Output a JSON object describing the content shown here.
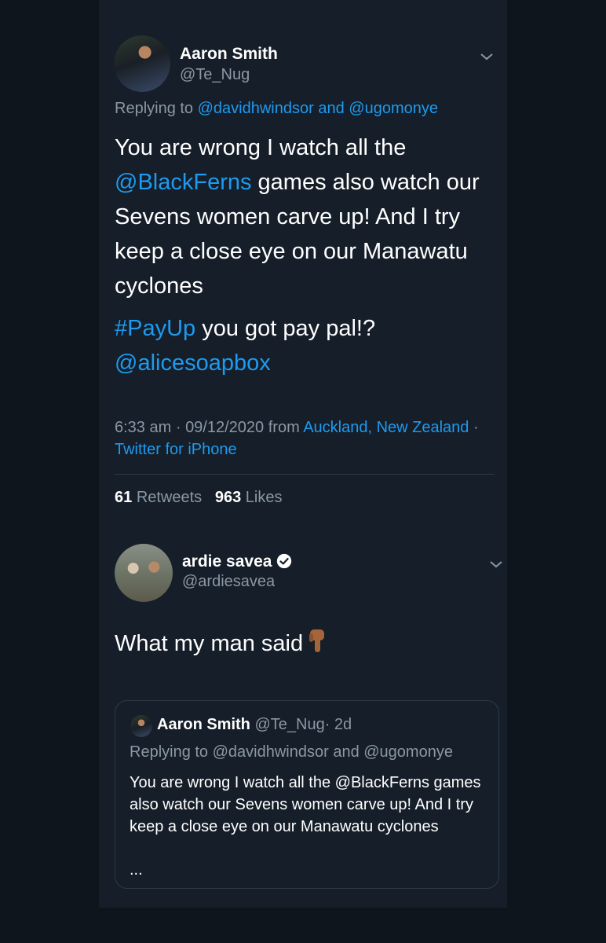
{
  "main_tweet": {
    "author_name": "Aaron Smith",
    "author_handle": "@Te_Nug",
    "replying_prefix": "Replying to",
    "replying_user1": "@davidhwindsor",
    "replying_and": "and",
    "replying_user2": "@ugomonye",
    "text_part1": "You are wrong I watch all the",
    "text_mention": "@BlackFerns",
    "text_part2": "games also watch our Sevens women carve up! And I try keep a close eye on our Manawatu cyclones",
    "hashtag": "#PayUp",
    "text_part3": "you got pay pal!?",
    "mention2": "@alicesoapbox",
    "time": "6:33 am",
    "dot": "·",
    "date": "09/12/2020",
    "from_label": "from",
    "location": "Auckland, New Zealand",
    "client": "Twitter for iPhone",
    "retweets_count": "61",
    "retweets_label": "Retweets",
    "likes_count": "963",
    "likes_label": "Likes"
  },
  "reply_tweet": {
    "author_name": "ardie savea",
    "author_handle": "@ardiesavea",
    "text": "What my man said"
  },
  "quoted_tweet": {
    "author_name": "Aaron Smith",
    "author_handle": "@Te_Nug",
    "age": "· 2d",
    "replying_line": "Replying to @davidhwindsor and @ugomonye",
    "text": "You are wrong I watch all the @BlackFerns games also watch our Sevens women carve up! And I try keep a close eye on our Manawatu cyclones",
    "ellipsis": "..."
  },
  "colors": {
    "background": "#0f151c",
    "panel": "#151e29",
    "link": "#1d9bf0",
    "muted": "#8b98a5"
  }
}
